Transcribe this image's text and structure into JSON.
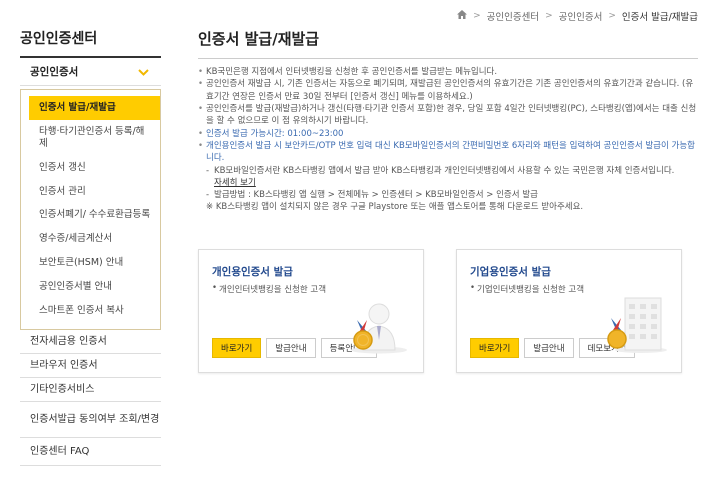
{
  "breadcrumb": [
    "홈",
    "공인인증센터",
    "공인인증서",
    "인증서 발급/재발급"
  ],
  "sidebar": {
    "title": "공인인증센터",
    "category": "공인인증서",
    "sub_items": [
      "인증서 발급/재발급",
      "타행·타기관인증서 등록/해제",
      "인증서 갱신",
      "인증서 관리",
      "인증서폐기/ 수수료환급등록",
      "영수증/세금계산서",
      "보안토큰(HSM) 안내",
      "공인인증서별 안내",
      "스마트폰 인증서 복사"
    ],
    "items": [
      "전자세금용 인증서",
      "브라우저 인증서",
      "기타인증서비스",
      "인증서발급 동의여부 조회/변경",
      "인증센터 FAQ"
    ]
  },
  "main": {
    "title": "인증서 발급/재발급",
    "desc": [
      "KB국민은행 지점에서 인터넷뱅킹을 신청한 후 공인인증서를 발급받는 메뉴입니다.",
      "공인인증서 재발급 시, 기존 인증서는 자동으로 폐기되며, 재발급된 공인인증서의 유효기간은 기존 공인인증서의 유효기간과 같습니다. (유효기간 연장은 인증서 만료 30일 전부터 [인증서 갱신] 메뉴를 이용하세요.)",
      "공인인증서를 발급(재발급)하거나 갱신(타행·타기관 인증서 포함)한 경우, 당일 포함 4일간 인터넷뱅킹(PC), 스타뱅킹(앱)에서는 대출 신청을 할 수 없으므로 이 점 유의하시기 바랍니다."
    ],
    "hours": "인증서 발급 가능시간: 01:00~23:00",
    "notice": "개인용인증서 발급 시 보안카드/OTP 번호 입력 대신 KB모바일인증서의 간편비밀번호 6자리와 패턴을 입력하여 공인인증서 발급이 가능합니다.",
    "notice_sub1": "KB모바일인증서란 KB스타뱅킹 앱에서 발급 받아 KB스타뱅킹과 개인인터넷뱅킹에서 사용할 수 있는 국민은행 자체 인증서입니다.",
    "notice_link": "자세히 보기",
    "notice_sub2": "발급방법 : KB스타뱅킹 앱 실행 > 전체메뉴 > 인증센터 > KB모바일인증서 > 인증서 발급",
    "notice_sub3": "※ KB스타뱅킹 앱이 설치되지 않은 경우 구글 Playstore 또는 애플 앱스토어를 통해 다운로드 받아주세요."
  },
  "cards": [
    {
      "title": "개인용인증서 발급",
      "desc": "개인인터넷뱅킹을 신청한 고객",
      "buttons": [
        "바로가기",
        "발급안내",
        "등록안내"
      ]
    },
    {
      "title": "기업용인증서 발급",
      "desc": "기업인터넷뱅킹을 신청한 고객",
      "buttons": [
        "바로가기",
        "발급안내",
        "데모보기"
      ]
    }
  ],
  "colors": {
    "accent": "#ffcc00",
    "link_blue": "#3a6ab0",
    "card_title": "#234a8e"
  }
}
